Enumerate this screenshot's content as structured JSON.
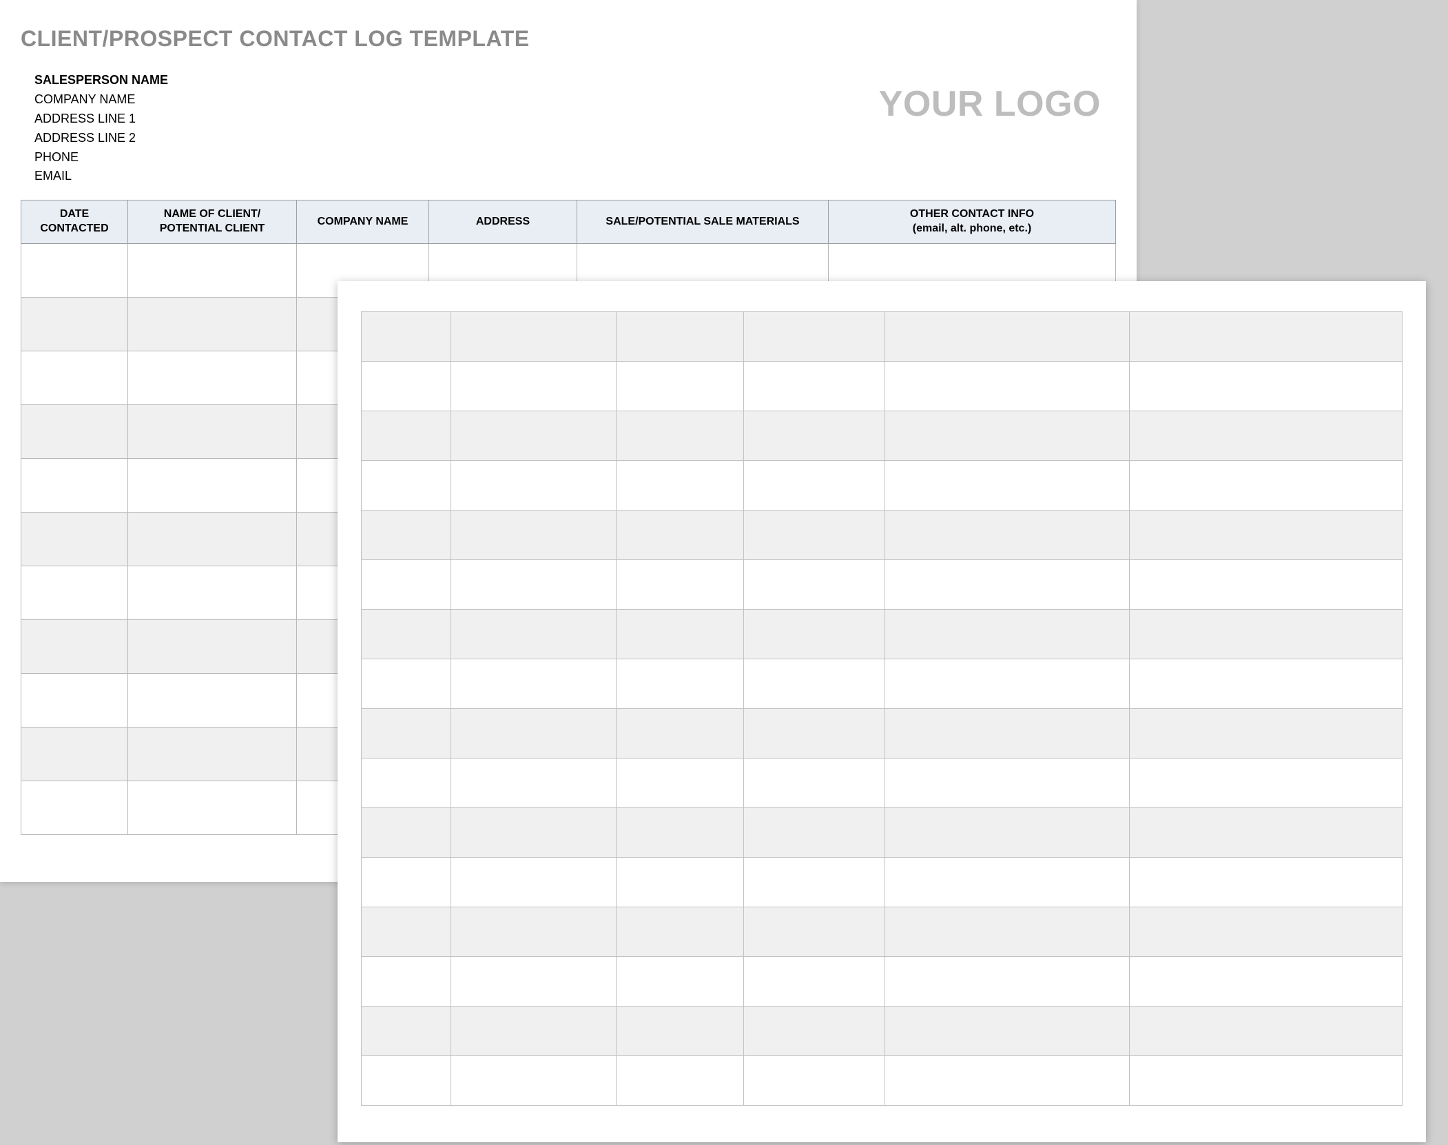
{
  "title": "CLIENT/PROSPECT CONTACT LOG TEMPLATE",
  "logo_placeholder": "YOUR LOGO",
  "salesperson": {
    "name_label": "SALESPERSON NAME",
    "company": "COMPANY NAME",
    "address1": "ADDRESS LINE 1",
    "address2": "ADDRESS LINE 2",
    "phone": "PHONE",
    "email": "EMAIL"
  },
  "columns": {
    "date": "DATE CONTACTED",
    "name": "NAME OF CLIENT/ POTENTIAL CLIENT",
    "company": "COMPANY NAME",
    "address": "ADDRESS",
    "materials": "SALE/POTENTIAL SALE MATERIALS",
    "other_line1": "OTHER CONTACT INFO",
    "other_line2": "(email, alt. phone, etc.)"
  }
}
